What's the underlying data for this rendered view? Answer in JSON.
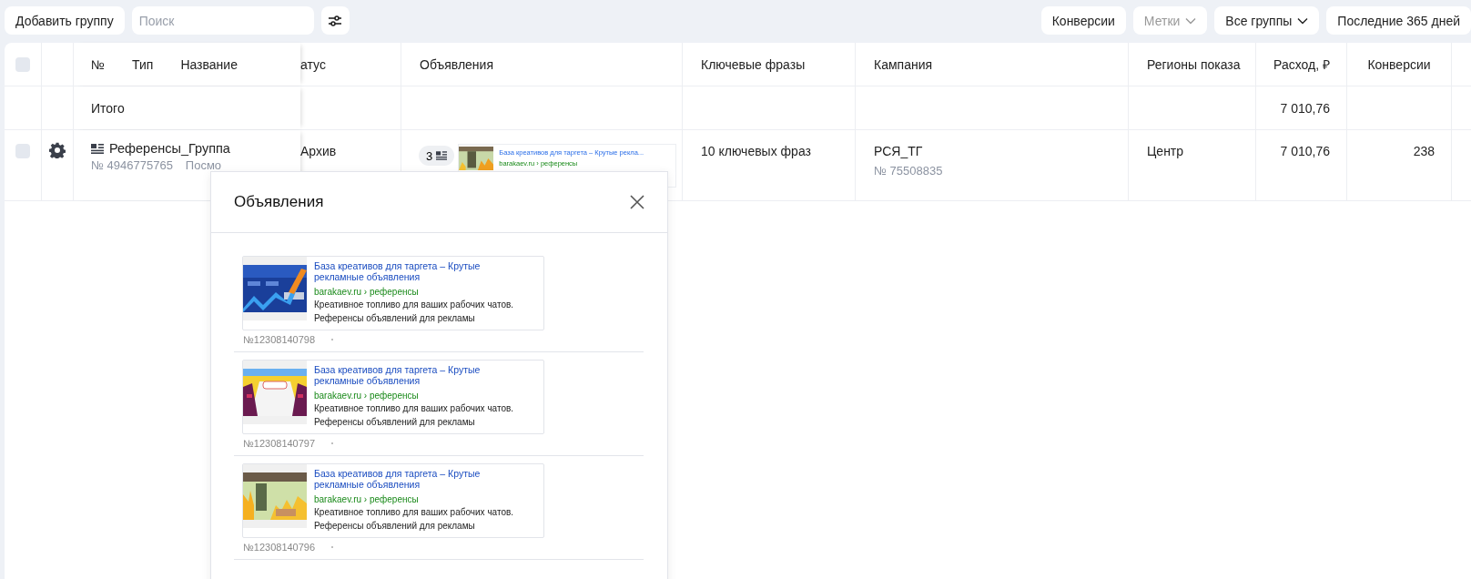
{
  "toolbar": {
    "add_button": "Добавить группу",
    "search": {
      "placeholder": "Поиск"
    },
    "right_buttons": [
      {
        "label": "Конверсии",
        "kind": "plain",
        "disabled": false
      },
      {
        "label": "Метки",
        "kind": "dropdown",
        "disabled": true
      },
      {
        "label": "Все группы",
        "kind": "dropdown",
        "disabled": false
      },
      {
        "label": "Последние 365 дней",
        "kind": "plain",
        "disabled": false
      }
    ]
  },
  "table": {
    "header": {
      "checked": false,
      "name_labels": [
        "№",
        "Тип",
        "Название"
      ],
      "columns": [
        "атус",
        "Объявления",
        "Ключевые фразы",
        "Кампания",
        "Регионы показа",
        "Расход, ₽",
        "Конверсии"
      ]
    },
    "total": {
      "label": "Итого",
      "cost": "7 010,76"
    },
    "rows": [
      {
        "checked": false,
        "name": "Референсы_Группа",
        "number": "№ 4946775765",
        "link": "Посмо",
        "status": "Архив",
        "ads_count": "3",
        "ad_preview": {
          "title": "База креативов для таргета – Крутые рекла...",
          "url": "barakaev.ru › референсы"
        },
        "phrases": "10 ключевых фраз",
        "campaign": "РСЯ_ТГ",
        "campaign_number": "№ 75508835",
        "region": "Центр",
        "cost": "7 010,76",
        "conversions": "238"
      }
    ]
  },
  "popup": {
    "title": "Объявления",
    "ads": [
      {
        "title": "База креативов для таргета – Крутые рекламные объявления",
        "url": "barakaev.ru › референсы",
        "text_lines": [
          "Креативное топливо для ваших рабочих чатов.",
          "Референсы объявлений для рекламы"
        ],
        "number": "№12308140798"
      },
      {
        "title": "База креативов для таргета – Крутые рекламные объявления",
        "url": "barakaev.ru › референсы",
        "text_lines": [
          "Креативное топливо для ваших рабочих чатов.",
          "Референсы объявлений для рекламы"
        ],
        "number": "№12308140797"
      },
      {
        "title": "База креативов для таргета – Крутые рекламные объявления",
        "url": "barakaev.ru › референсы",
        "text_lines": [
          "Креативное топливо для ваших рабочих чатов.",
          "Референсы объявлений для рекламы"
        ],
        "number": "№12308140796"
      }
    ]
  }
}
